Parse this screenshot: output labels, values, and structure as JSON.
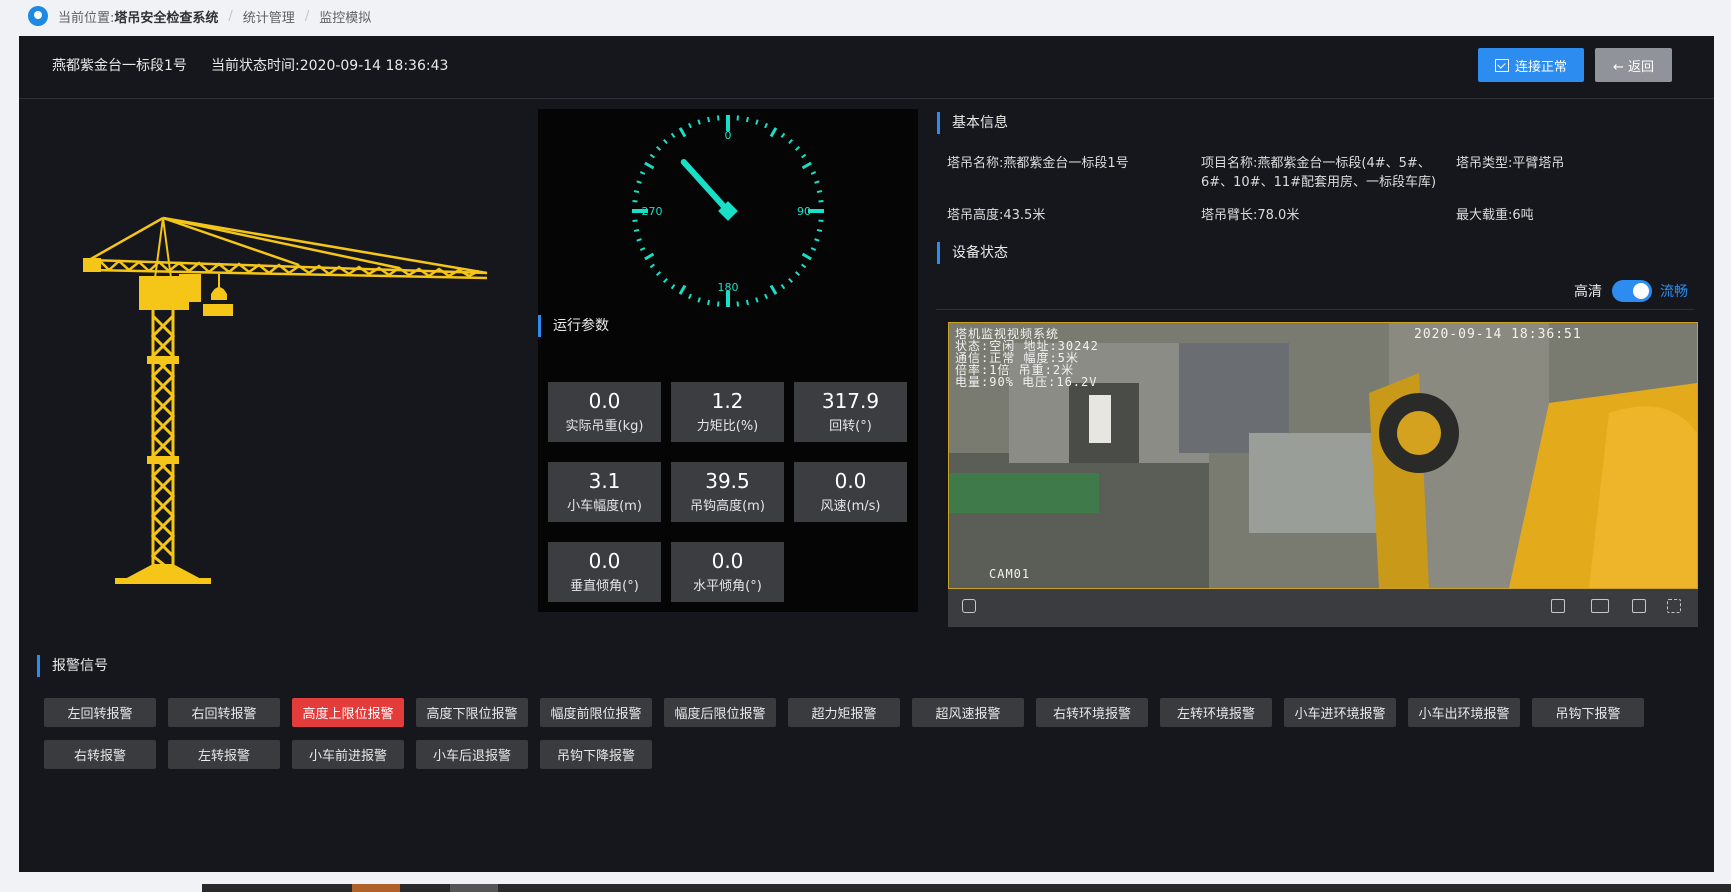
{
  "breadcrumb": {
    "location_label": "当前位置:",
    "items": [
      "塔吊安全检查系统",
      "统计管理",
      "监控模拟"
    ],
    "separator": "/"
  },
  "header": {
    "crane_name": "燕都紫金台一标段1号",
    "status_time": "当前状态时间:2020-09-14 18:36:43",
    "connect_button": "连接正常",
    "back_button": "← 返回"
  },
  "gauge": {
    "labels": [
      "0",
      "90",
      "180",
      "270"
    ],
    "pointer_angle_deg": 317.9
  },
  "run_params": {
    "title": "运行参数",
    "cells": [
      {
        "value": "0.0",
        "label": "实际吊重(kg)"
      },
      {
        "value": "1.2",
        "label": "力矩比(%)"
      },
      {
        "value": "317.9",
        "label": "回转(°)"
      },
      {
        "value": "3.1",
        "label": "小车幅度(m)"
      },
      {
        "value": "39.5",
        "label": "吊钩高度(m)"
      },
      {
        "value": "0.0",
        "label": "风速(m/s)"
      },
      {
        "value": "0.0",
        "label": "垂直倾角(°)"
      },
      {
        "value": "0.0",
        "label": "水平倾角(°)"
      }
    ]
  },
  "basic_info": {
    "title": "基本信息",
    "crane_name": "塔吊名称:燕都紫金台一标段1号",
    "project_line1": "项目名称:燕都紫金台一标段(4#、5#、",
    "project_line2": "6#、10#、11#配套用房、一标段车库)",
    "crane_type": "塔吊类型:平臂塔吊",
    "height": "塔吊高度:43.5米",
    "arm_length": "塔吊臂长:78.0米",
    "max_load": "最大载重:6吨"
  },
  "device_status": {
    "title": "设备状态",
    "hd_label": "高清",
    "smooth_label": "流畅",
    "video_overlay_line1": "塔机监视视频系统",
    "video_overlay_line2": "状态:空闲 地址:30242",
    "video_overlay_line3": "通信:正常 幅度:5米",
    "video_overlay_line4": "倍率:1倍 吊重:2米",
    "video_overlay_line5": "电量:90% 电压:16.2V",
    "video_timestamp": "2020-09-14 18:36:51",
    "video_cam": "CAM01"
  },
  "alarms": {
    "title": "报警信号",
    "items": [
      "左回转报警",
      "右回转报警",
      "高度上限位报警",
      "高度下限位报警",
      "幅度前限位报警",
      "幅度后限位报警",
      "超力矩报警",
      "超风速报警",
      "右转环境报警",
      "左转环境报警",
      "小车进环境报警",
      "小车出环境报警",
      "吊钩下报警",
      "右转报警",
      "左转报警",
      "小车前进报警",
      "小车后退报警",
      "吊钩下降报警"
    ],
    "active_index": 2
  },
  "colors": {
    "accent": "#2d8cf0",
    "crane": "#f5c518",
    "gauge": "#18e0c8",
    "alarm_active": "#e43b3b"
  }
}
